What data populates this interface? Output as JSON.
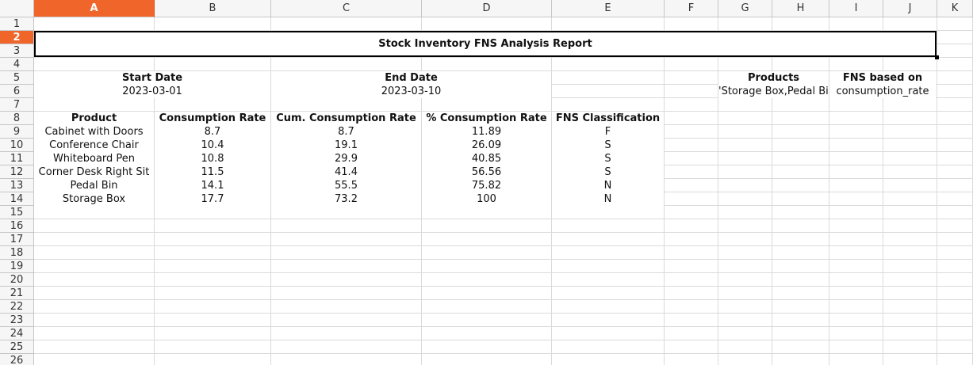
{
  "columns": [
    "A",
    "B",
    "C",
    "D",
    "E",
    "F",
    "G",
    "H",
    "I",
    "J",
    "K"
  ],
  "active_column": "A",
  "rows": [
    1,
    2,
    3,
    4,
    5,
    6,
    7,
    8,
    9,
    10,
    11,
    12,
    13,
    14,
    15,
    16,
    17,
    18,
    19,
    20,
    21,
    22,
    23,
    24,
    25,
    26
  ],
  "active_row": 2,
  "report_title": "Stock Inventory FNS Analysis Report",
  "params": {
    "start_date_label": "Start Date",
    "start_date_value": "2023-03-01",
    "end_date_label": "End Date",
    "end_date_value": "2023-03-10",
    "products_label": "Products",
    "products_value": "'Storage Box,Pedal Bin",
    "fns_based_label": "FNS based on",
    "fns_based_value": "consumption_rate"
  },
  "table": {
    "headers": [
      "Product",
      "Consumption Rate",
      "Cum. Consumption Rate",
      "% Consumption Rate",
      "FNS Classification"
    ],
    "rows": [
      [
        "Cabinet with Doors",
        "8.7",
        "8.7",
        "11.89",
        "F"
      ],
      [
        "Conference Chair",
        "10.4",
        "19.1",
        "26.09",
        "S"
      ],
      [
        "Whiteboard Pen",
        "10.8",
        "29.9",
        "40.85",
        "S"
      ],
      [
        "Corner Desk Right Sit",
        "11.5",
        "41.4",
        "56.56",
        "S"
      ],
      [
        "Pedal Bin",
        "14.1",
        "55.5",
        "75.82",
        "N"
      ],
      [
        "Storage Box",
        "17.7",
        "73.2",
        "100",
        "N"
      ]
    ]
  }
}
